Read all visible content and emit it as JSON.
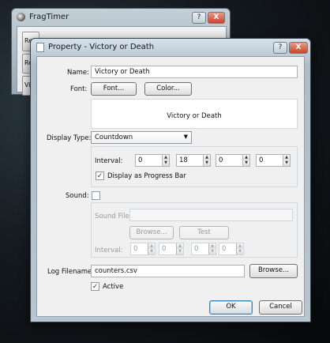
{
  "background_window": {
    "title": "FragTimer",
    "help_label": "?",
    "close_label": "X",
    "buttons": [
      "Res",
      "Res",
      "Victo"
    ],
    "progress_text": "■■ ■■ ■■■ ■■■"
  },
  "dialog": {
    "title": "Property - Victory or Death",
    "help_label": "?",
    "close_label": "X",
    "name_label": "Name:",
    "name_value": "Victory or Death",
    "font_label": "Font:",
    "font_button": "Font...",
    "color_button": "Color...",
    "preview_text": "Victory or Death",
    "display_type_label": "Display Type:",
    "display_type_value": "Countdown",
    "interval_label": "Interval:",
    "interval_values": [
      "0",
      "18",
      "0",
      "0"
    ],
    "progress_bar_label": "Display as Progress Bar",
    "progress_bar_checked": "✓",
    "sound_label": "Sound:",
    "sound_file_label": "Sound File:",
    "sound_file_value": "",
    "browse_sound_button": "Browse...",
    "test_button": "Test",
    "sound_interval_label": "Interval:",
    "sound_interval_values": [
      "0",
      "0",
      "0",
      "0"
    ],
    "log_filename_label": "Log Filename:",
    "log_filename_value": "counters.csv",
    "browse_log_button": "Browse...",
    "active_label": "Active",
    "active_checked": "✓",
    "ok_button": "OK",
    "cancel_button": "Cancel"
  }
}
